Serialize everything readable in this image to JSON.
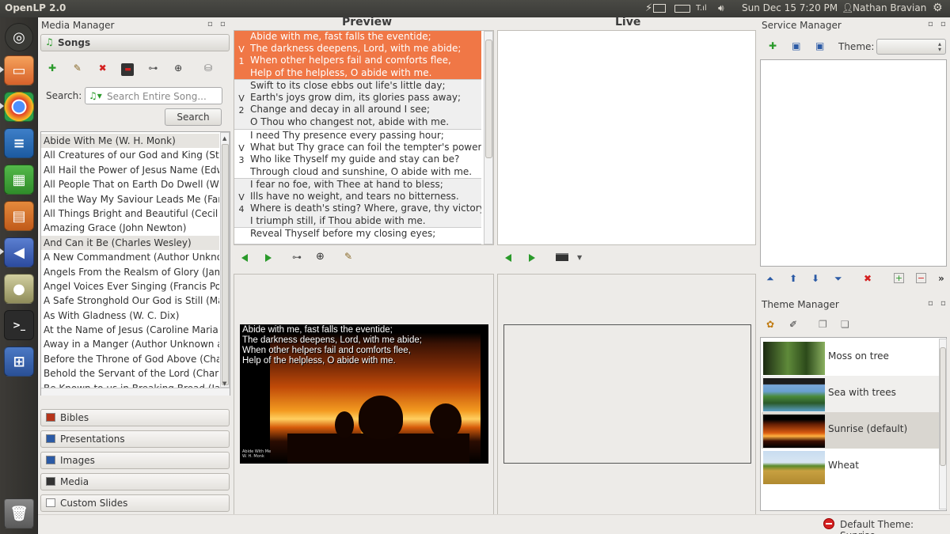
{
  "top_panel": {
    "app_title": "OpenLP 2.0",
    "clock": "Sun Dec 15  7:20 PM",
    "user": "Nathan Bravian"
  },
  "media_manager": {
    "title": "Media Manager",
    "section": "Songs",
    "search_label": "Search:",
    "search_placeholder": "Search Entire Song...",
    "search_button": "Search",
    "songs": [
      "Abide With Me (W. H. Monk)",
      "All Creatures of our God and King (St.",
      "All Hail the Power of Jesus Name (Edw",
      "All People That on Earth Do Dwell (Wi",
      "All the Way My Saviour Leads Me (Fan",
      "All Things Bright and Beautiful (Cecil F",
      "Amazing Grace (John Newton)",
      "And Can it Be (Charles Wesley)",
      "A New Commandment (Author Unkno",
      "Angels From the Realsm of Glory (Jam",
      "Angel Voices Ever Singing (Francis Pot",
      "A Safe Stronghold Our God is Still (Ma",
      "As With Gladness (W. C. Dix)",
      "At the Name of Jesus (Caroline Maria",
      "Away in a Manger (Author Unknown a",
      "Before the Throne of God Above (Cha",
      "Behold the Servant of the Lord (Charle",
      "Be Known to us in Breaking Bread (Jar"
    ],
    "drawers": [
      "Bibles",
      "Presentations",
      "Images",
      "Media",
      "Custom Slides"
    ]
  },
  "preview": {
    "title": "Preview",
    "verses": [
      {
        "tag": "V\n1",
        "lines": "Abide with me, fast falls the eventide;\nThe darkness deepens, Lord, with me abide;\nWhen other helpers fail and comforts flee,\nHelp of the helpless, O abide with me."
      },
      {
        "tag": "V\n2",
        "lines": "Swift to its close ebbs out life's little day;\nEarth's joys grow dim, its glories pass away;\nChange and decay in all around I see;\nO Thou who changest not, abide with me."
      },
      {
        "tag": "V\n3",
        "lines": "I need Thy presence every passing hour;\nWhat but Thy grace can foil the tempter's power?\nWho like Thyself my guide and stay can be?\nThrough cloud and sunshine, O abide with me."
      },
      {
        "tag": "V\n4",
        "lines": "I fear no foe, with Thee at hand to bless;\nIlls have no weight, and tears no bitterness.\nWhere is death's sting? Where, grave, thy victory?\nI triumph still, if Thou abide with me."
      },
      {
        "tag": "",
        "lines": "Reveal Thyself before my closing eyes;"
      }
    ],
    "slide_text": "Abide with me, fast falls the eventide;\nThe darkness deepens, Lord, with me abide;\nWhen other helpers fail and comforts flee,\nHelp of the helpless, O abide with me.",
    "slide_footer": "Abide With Me\nW. H. Monk"
  },
  "live": {
    "title": "Live"
  },
  "service_manager": {
    "title": "Service Manager",
    "theme_label": "Theme:"
  },
  "theme_manager": {
    "title": "Theme Manager",
    "themes": [
      "Moss on tree",
      "Sea with trees",
      "Sunrise (default)",
      "Wheat"
    ]
  },
  "status_bar": {
    "default_theme": "Default Theme: Sunrise"
  },
  "colors": {
    "selected_verse": "#f07746",
    "accent_green": "#2a9a2a",
    "delete_red": "#d42020"
  }
}
